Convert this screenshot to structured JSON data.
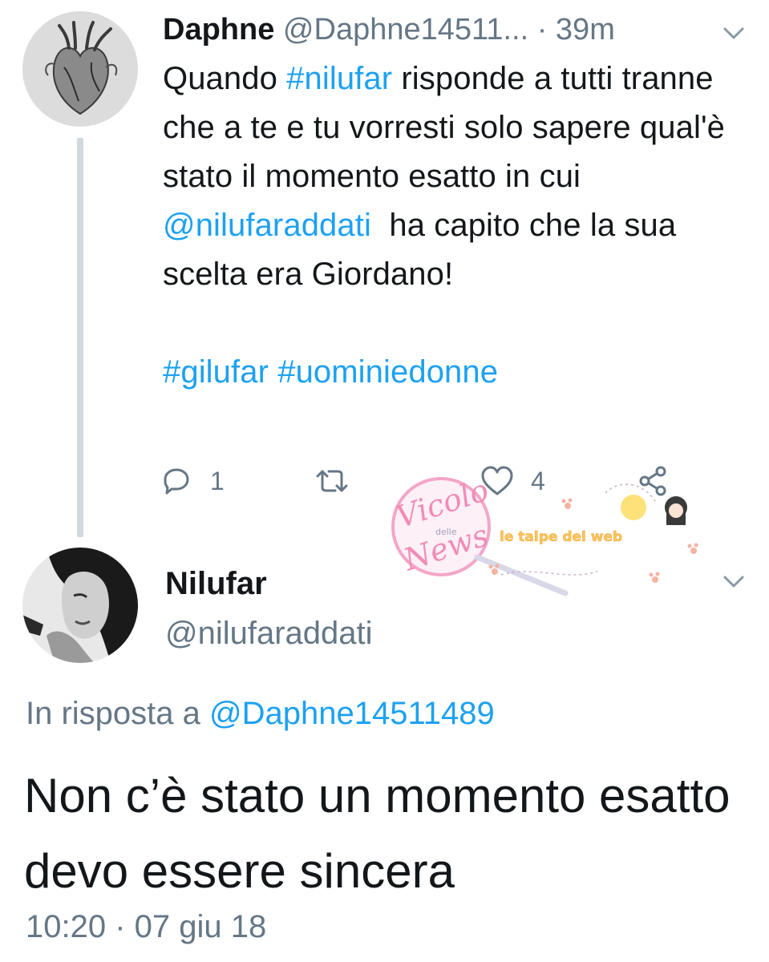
{
  "tweet1": {
    "author_name": "Daphne",
    "author_handle": "@Daphne14511...",
    "separator": " · ",
    "time": "39m",
    "avatar_icon": "anatomical-heart-icon",
    "text_parts": [
      {
        "text": "Quando ",
        "link": false
      },
      {
        "text": "#nilufar",
        "link": true
      },
      {
        "text": " risponde a tutti tranne che a te e tu vorresti solo sapere qual'è stato il momento esatto in cui ",
        "link": false
      },
      {
        "text": "@nilufaraddati",
        "link": true
      },
      {
        "text": "  ha capito che la sua scelta era Giordano!",
        "link": false
      }
    ],
    "hashtags": [
      "#gilufar",
      "#uominiedonne"
    ],
    "replies_count": "1",
    "likes_count": "4"
  },
  "tweet2": {
    "author_name": "Nilufar",
    "author_handle": "@nilufaraddati",
    "reply_prefix": "In risposta a ",
    "reply_to": "@Daphne14511489",
    "text": "Non c’è stato un momento esatto devo essere sincera",
    "timestamp": "10:20 · 07 giu 18"
  },
  "watermark": {
    "brand_line1": "Vicolo",
    "brand_small": "delle",
    "brand_line2": "News",
    "tagline": "le talpe del web"
  },
  "colors": {
    "link": "#1da1f2",
    "muted": "#657786",
    "text": "#14171a",
    "thread_line": "#cfd9de"
  }
}
